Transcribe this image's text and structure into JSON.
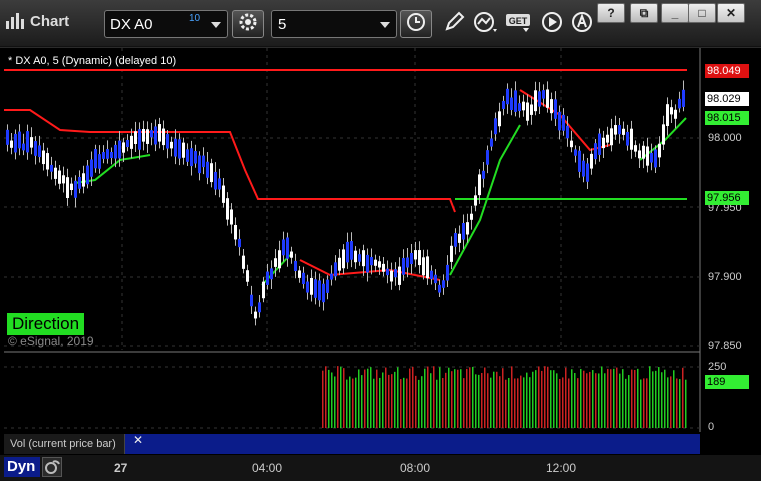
{
  "app": {
    "title": "Chart"
  },
  "toolbar": {
    "symbol": "DX A0",
    "symbol_badge": "10",
    "interval": "5",
    "buttons": [
      "settings-icon",
      "clock-icon",
      "pencil-icon",
      "study-icon",
      "get-icon",
      "play-icon",
      "alert-icon"
    ],
    "get_label": "GET",
    "window_buttons": [
      "?",
      "⧉",
      "_",
      "□",
      "✕"
    ]
  },
  "chart": {
    "header": "* DX A0, 5 (Dynamic) (delayed 10)",
    "direction_label": "Direction",
    "copyright": "© eSignal, 2019",
    "price_ticks": [
      "98.000",
      "97.950",
      "97.900",
      "97.850"
    ],
    "price_tags": {
      "top": "98.049",
      "last": "98.029",
      "green_upper": "98.015",
      "green_lower": "97.956"
    },
    "colors": {
      "up_candle": "#ffffff",
      "down_candle": "#1f3bff",
      "stop_line_red": "#ff1a1a",
      "stop_line_green": "#22dd22",
      "tag_red": "#dd1111",
      "tag_green": "#33ee33"
    }
  },
  "volume": {
    "title": "Vol (current price bar)",
    "close_label": "✕",
    "ticks": [
      "250",
      "0"
    ],
    "current_tag": "189"
  },
  "time_axis": {
    "dyn_label": "Dyn",
    "labels": [
      "27",
      "04:00",
      "08:00",
      "12:00"
    ]
  }
}
